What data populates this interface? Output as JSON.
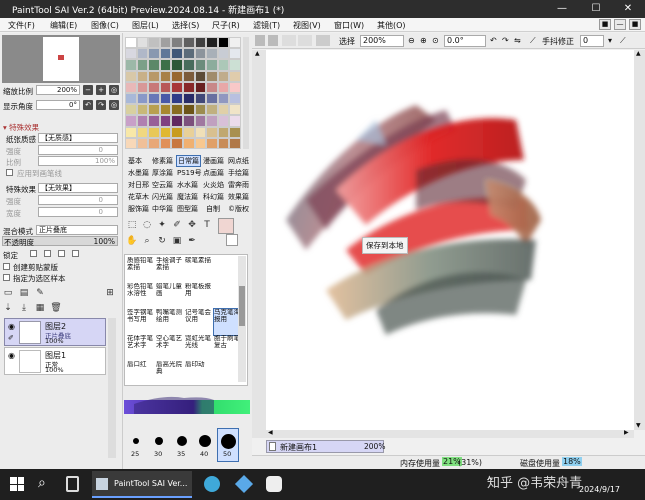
{
  "window": {
    "title": "PaintTool SAI Ver.2 (64bit) Preview.2024.08.14 - 新建画布1 (*)",
    "minimize": "—",
    "maximize": "☐",
    "close": "✕"
  },
  "menu": {
    "items": [
      "文件(F)",
      "编辑(E)",
      "图像(C)",
      "图层(L)",
      "选择(S)",
      "尺子(R)",
      "滤镜(T)",
      "视图(V)",
      "窗口(W)",
      "其他(O)"
    ],
    "right_buttons": [
      "■",
      "—",
      "■"
    ]
  },
  "navigator": {
    "zoom_label": "缩放比例",
    "zoom_value": "200%",
    "angle_label": "显示角度",
    "angle_value": "0°"
  },
  "effects": {
    "header": "特殊效果",
    "paper_label": "纸张质感",
    "paper_value": "【无质感】",
    "strength_label": "强度",
    "strength_value": "0",
    "ratio_label": "比例",
    "ratio_value": "100%",
    "apply_brush": "应用到画笔线",
    "effect_label": "特殊效果",
    "effect_value": "【无效果】",
    "strength2_label": "强度",
    "strength2_value": "0",
    "width_label": "宽度",
    "width_value": "0"
  },
  "layer_props": {
    "blend_label": "混合模式",
    "blend_value": "正片叠底",
    "opacity_label": "不透明度",
    "opacity_value": "100%",
    "lock_label": "锁定",
    "clip_label": "创建剪贴蒙版",
    "select_src_label": "指定为选区样本"
  },
  "layers": [
    {
      "name": "图层2",
      "mode": "正片叠底",
      "opacity": "100%"
    },
    {
      "name": "图层1",
      "mode": "正常",
      "opacity": "100%"
    }
  ],
  "brush_tabs": [
    [
      "基本",
      "修素篇",
      "日常篇",
      "漫画篇",
      "网点纸"
    ],
    [
      "水墨篇",
      "厚涂篇",
      "PS19号",
      "点画篇",
      "手绘篇"
    ],
    [
      "对日邢",
      "空云篇",
      "水水篇",
      "火炎焰",
      "雷奔雨"
    ],
    [
      "花草木",
      "闪光篇",
      "魔法篇",
      "科幻篇",
      "效果篇"
    ],
    [
      "服饰篇",
      "中华篇",
      "图型篇",
      "自制",
      "©版权"
    ]
  ],
  "brushes": [
    [
      "质感铅笔素描",
      "手绘调子素描",
      "碳笔素描"
    ],
    [
      "彩色铅笔水溶性",
      "蜡笔儿童画",
      "粉笔板报用"
    ],
    [
      "签字钢笔书写用",
      "鸭嘴笔测绘用",
      "记号笔会议用",
      "马克笔海报用"
    ],
    [
      "花体字笔艺术字",
      "空心笔艺术字",
      "霓虹光笔光线",
      "胞于刷笔复古"
    ],
    [
      "唇口红",
      "唇高光院典",
      "唇印动",
      ""
    ]
  ],
  "brush_sizes": [
    "25",
    "30",
    "35",
    "40",
    "50"
  ],
  "canvas_toolbar": {
    "select_label": "选择",
    "zoom": "200%",
    "angle": "0.0°",
    "stabilizer_label": "手抖修正",
    "stabilizer_value": "0"
  },
  "canvas": {
    "tooltip": "保存到本地"
  },
  "status": {
    "doc_name": "新建画布1",
    "doc_zoom": "200%",
    "mem_label": "内存使用量",
    "mem_value": "21%",
    "mem_detail": "(31%)",
    "disk_label": "磁盘使用量",
    "disk_value": "18%"
  },
  "taskbar": {
    "app_label": "PaintTool SAI Ver...",
    "watermark": "知乎 @韦荣舟青",
    "time": "",
    "date": "2024/9/17"
  },
  "colors": {
    "accent": "#3e6fb0",
    "selected_layer": "#d6d6f5",
    "brush_highlight": "#cfe0ff"
  }
}
